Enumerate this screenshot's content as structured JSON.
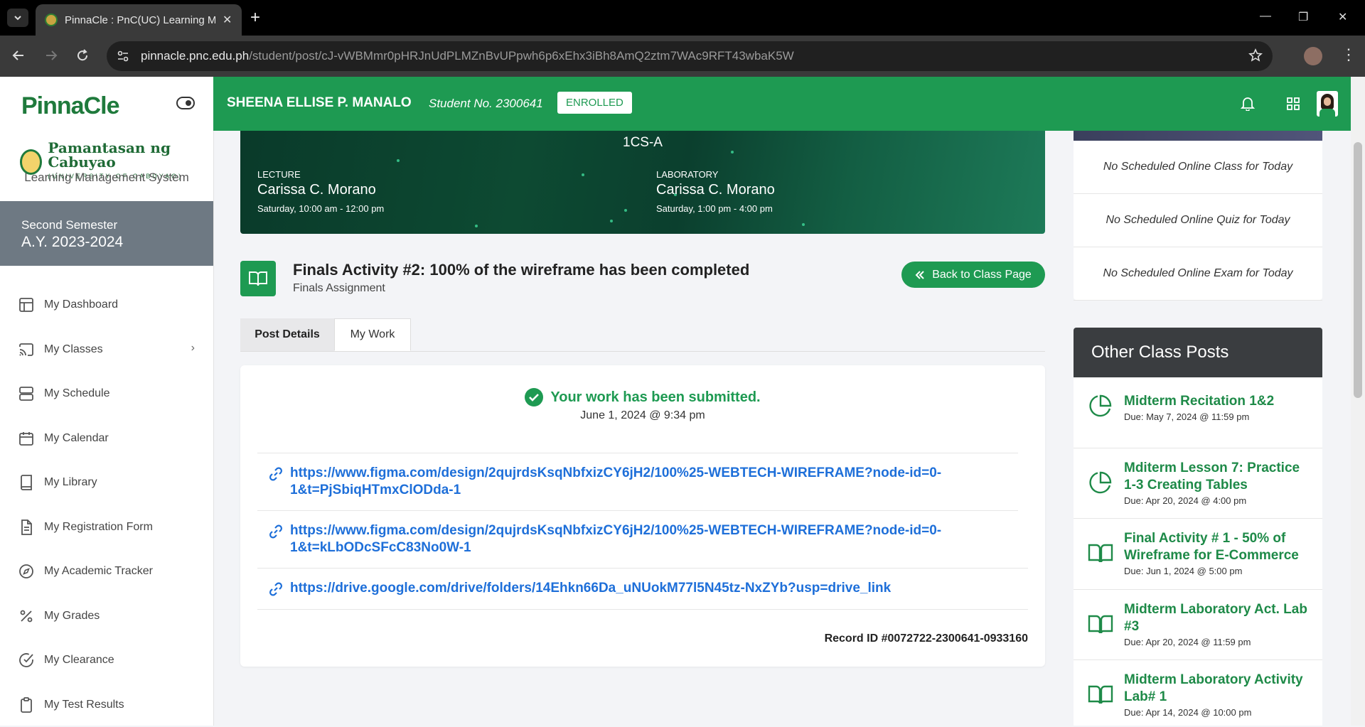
{
  "browser": {
    "tab_title": "PinnaCle : PnC(UC) Learning Ma",
    "url_domain": "pinnacle.pnc.edu.ph",
    "url_path": "/student/post/cJ-vWBMmr0pHRJnUdPLMZnBvUPpwh6p6xEhx3iBh8AmQ2ztm7WAc9RFT43wbaK5W"
  },
  "sidebar": {
    "logo": "PinnaCle",
    "university_name": "Pamantasan ng Cabuyao",
    "university_sub": "(UNIVERSITY OF CABUYAO)",
    "lms_label": "Learning Management System",
    "semester": "Second Semester",
    "academic_year": "A.Y. 2023-2024",
    "items": [
      {
        "label": "My Dashboard",
        "icon": "dashboard-icon"
      },
      {
        "label": "My Classes",
        "icon": "cast-icon"
      },
      {
        "label": "My Schedule",
        "icon": "schedule-icon"
      },
      {
        "label": "My Calendar",
        "icon": "calendar-icon"
      },
      {
        "label": "My Library",
        "icon": "book-icon"
      },
      {
        "label": "My Registration Form",
        "icon": "document-icon"
      },
      {
        "label": "My Academic Tracker",
        "icon": "compass-icon"
      },
      {
        "label": "My Grades",
        "icon": "percent-icon"
      },
      {
        "label": "My Clearance",
        "icon": "check-circle-icon"
      },
      {
        "label": "My Test Results",
        "icon": "clipboard-icon"
      }
    ]
  },
  "header": {
    "student_name": "SHEENA ELLISE P. MANALO",
    "student_no": "Student No. 2300641",
    "status_badge": "ENROLLED"
  },
  "banner": {
    "section": "1CS-A",
    "lecture_label": "LECTURE",
    "lecture_instructor": "Carissa C. Morano",
    "lecture_time": "Saturday, 10:00 am - 12:00 pm",
    "lab_label": "LABORATORY",
    "lab_instructor": "Carissa C. Morano",
    "lab_time": "Saturday, 1:00 pm - 4:00 pm"
  },
  "post": {
    "title": "Finals Activity #2: 100% of the wireframe has been completed",
    "subtitle": "Finals Assignment",
    "back_button": "Back to Class Page"
  },
  "tabs": [
    "Post Details",
    "My Work"
  ],
  "work": {
    "status": "Your work has been submitted.",
    "date": "June 1, 2024 @ 9:34 pm",
    "links": [
      "https://www.figma.com/design/2qujrdsKsqNbfxizCY6jH2/100%25-WEBTECH-WIREFRAME?node-id=0-1&t=PjSbiqHTmxClODda-1",
      "https://www.figma.com/design/2qujrdsKsqNbfxizCY6jH2/100%25-WEBTECH-WIREFRAME?node-id=0-1&t=kLbODcSFcC83No0W-1",
      "https://drive.google.com/drive/folders/14Ehkn66Da_uNUokM77l5N45tz-NxZYb?usp=drive_link"
    ],
    "record_id": "Record ID #0072722-2300641-0933160"
  },
  "schedule": [
    "No Scheduled Online Class for Today",
    "No Scheduled Online Quiz for Today",
    "No Scheduled Online Exam for Today"
  ],
  "other_posts": {
    "title": "Other Class Posts",
    "items": [
      {
        "title": "Midterm Recitation 1&2",
        "due": "Due: May 7, 2024 @ 11:59 pm",
        "icon": "pie-chart-icon"
      },
      {
        "title": "Mditerm Lesson 7: Practice 1-3 Creating Tables",
        "due": "Due: Apr 20, 2024 @ 4:00 pm",
        "icon": "pie-chart-icon"
      },
      {
        "title": "Final Activity # 1 - 50% of Wireframe for E-Commerce",
        "due": "Due: Jun 1, 2024 @ 5:00 pm",
        "icon": "book-open-icon"
      },
      {
        "title": "Midterm Laboratory Act. Lab #3",
        "due": "Due: Apr 20, 2024 @ 11:59 pm",
        "icon": "book-open-icon"
      },
      {
        "title": "Midterm Laboratory Activity Lab# 1",
        "due": "Due: Apr 14, 2024 @ 10:00 pm",
        "icon": "book-open-icon"
      }
    ]
  },
  "colors": {
    "brand_green": "#1e9a52",
    "link_blue": "#1e6fd9",
    "sidebar_semester": "#6e7983"
  }
}
